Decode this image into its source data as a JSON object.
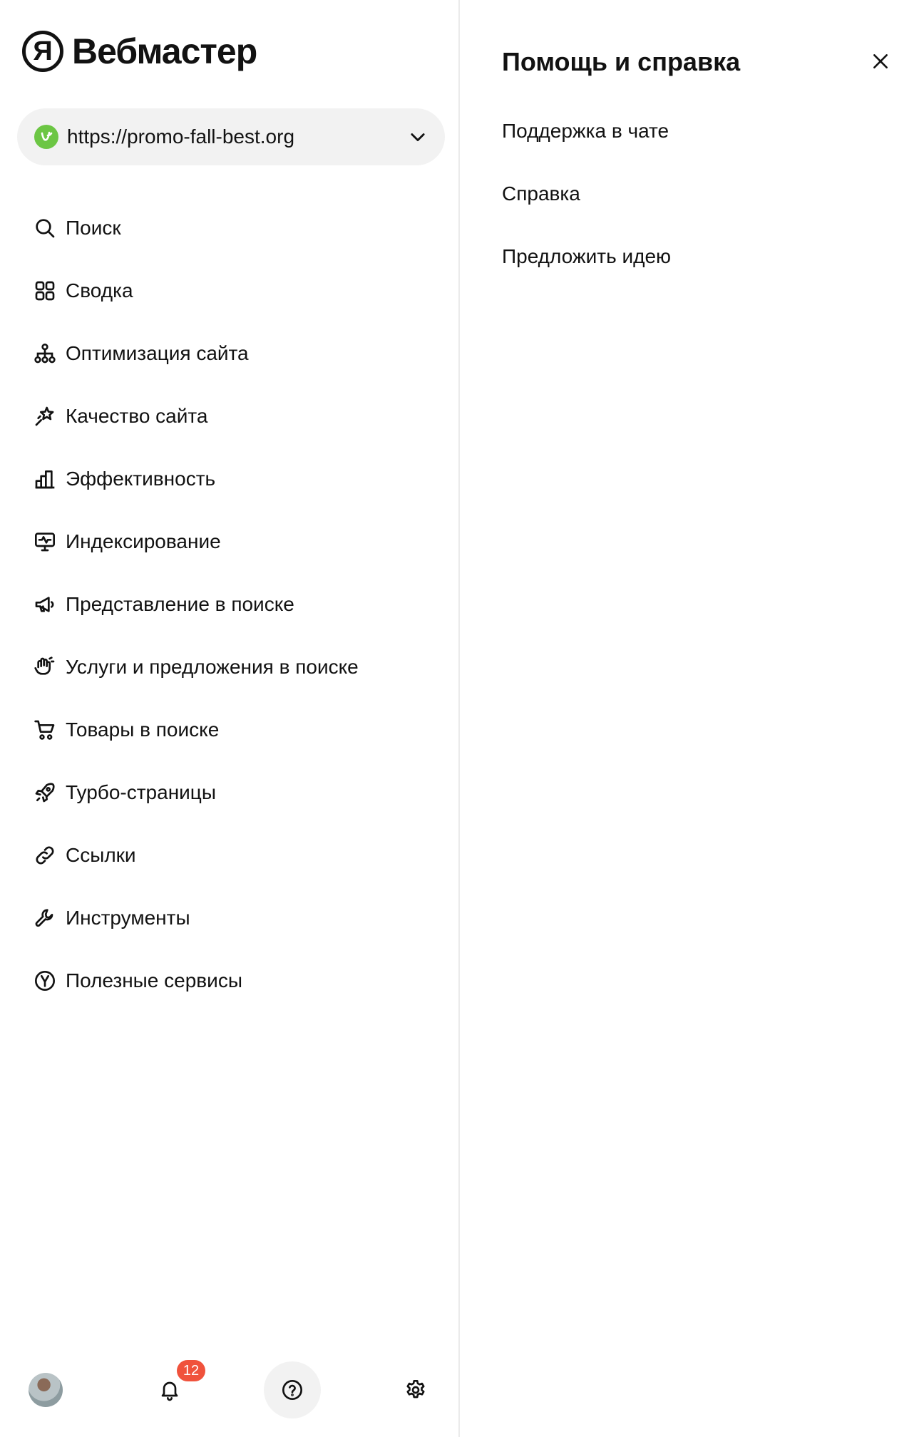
{
  "app": {
    "logo_mark": "Я",
    "title": "Вебмастер"
  },
  "site_selector": {
    "url": "https://promo-fall-best.org",
    "favicon_color": "#6cc644"
  },
  "nav": [
    {
      "label": "Поиск",
      "icon": "search-icon"
    },
    {
      "label": "Сводка",
      "icon": "dashboard-grid-icon"
    },
    {
      "label": "Оптимизация сайта",
      "icon": "sitemap-icon"
    },
    {
      "label": "Качество сайта",
      "icon": "sparkle-star-icon"
    },
    {
      "label": "Эффективность",
      "icon": "bar-chart-icon"
    },
    {
      "label": "Индексирование",
      "icon": "monitor-pulse-icon"
    },
    {
      "label": "Представление в поиске",
      "icon": "megaphone-icon"
    },
    {
      "label": "Услуги и предложения в поиске",
      "icon": "hand-service-icon"
    },
    {
      "label": "Товары в поиске",
      "icon": "cart-icon"
    },
    {
      "label": "Турбо-страницы",
      "icon": "rocket-icon"
    },
    {
      "label": "Ссылки",
      "icon": "link-icon"
    },
    {
      "label": "Инструменты",
      "icon": "wrench-icon"
    },
    {
      "label": "Полезные сервисы",
      "icon": "yandex-services-icon"
    }
  ],
  "footer": {
    "notifications_count": "12"
  },
  "help_panel": {
    "title": "Помощь и справка",
    "links": [
      "Поддержка в чате",
      "Справка",
      "Предложить идею"
    ]
  },
  "colors": {
    "accent_badge": "#f0523c",
    "text": "#121212",
    "pill_bg": "#f2f2f2"
  }
}
